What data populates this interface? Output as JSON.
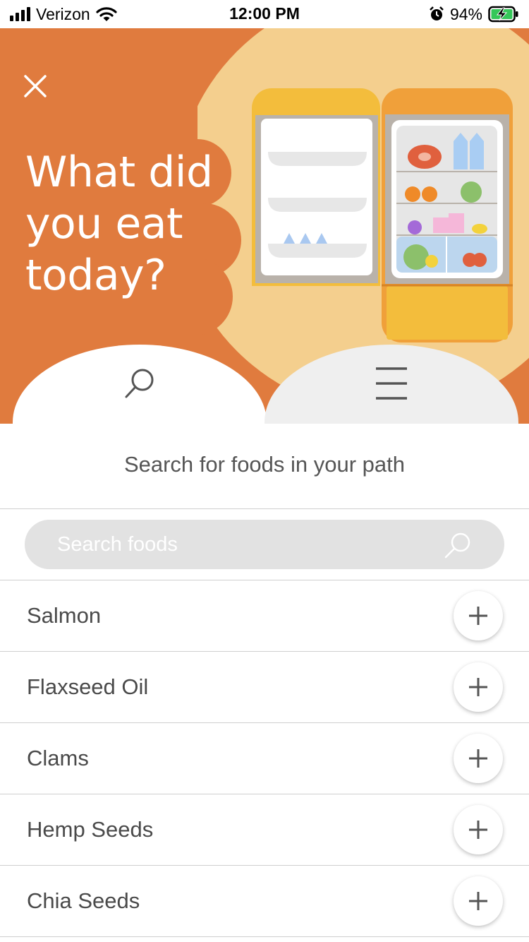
{
  "status_bar": {
    "carrier": "Verizon",
    "time": "12:00 PM",
    "battery": "94%",
    "icons": [
      "signal-icon",
      "wifi-icon",
      "alarm-icon",
      "battery-charging-icon"
    ]
  },
  "hero": {
    "title_lines": [
      "What did",
      "you eat",
      "today?"
    ],
    "close_icon": "close-icon",
    "illustration": "refrigerator-illustration",
    "tabs": [
      {
        "name": "search-mode-tab",
        "icon": "search-icon",
        "selected": true
      },
      {
        "name": "list-mode-tab",
        "icon": "menu-icon",
        "selected": false
      }
    ]
  },
  "content": {
    "section_title": "Search for foods in your path",
    "search": {
      "placeholder": "Search foods",
      "value": ""
    },
    "foods": [
      {
        "label": "Salmon"
      },
      {
        "label": "Flaxseed Oil"
      },
      {
        "label": "Clams"
      },
      {
        "label": "Hemp Seeds"
      },
      {
        "label": "Chia Seeds"
      }
    ]
  },
  "colors": {
    "hero_orange": "#e07b3e",
    "hero_cream": "#f4cf8e",
    "fridge_yellow": "#f3bd3c",
    "fridge_orange": "#f0a03a",
    "text_gray": "#4a4a4a"
  }
}
